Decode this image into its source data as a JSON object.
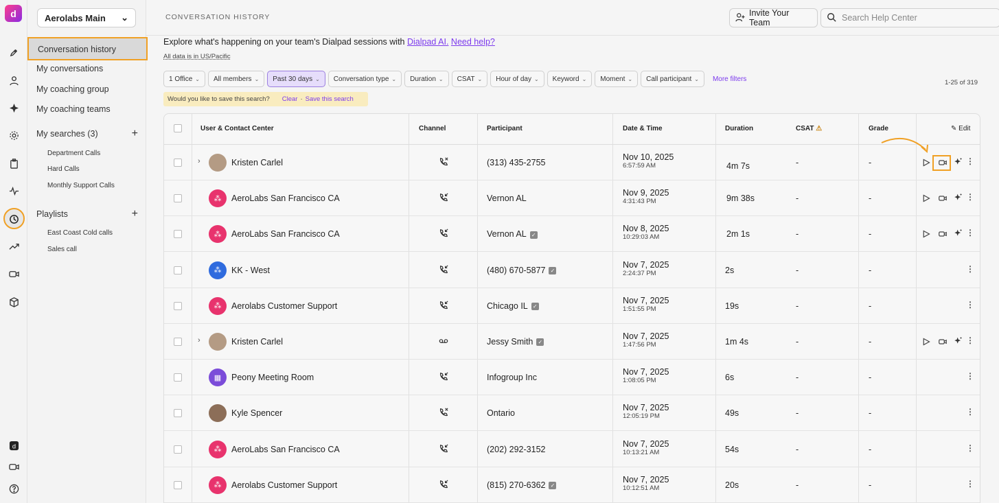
{
  "rail": {
    "logo": "d"
  },
  "sidebar": {
    "workspace": "Aerolabs Main",
    "items": [
      "Conversation history",
      "My conversations",
      "My coaching group",
      "My coaching teams"
    ],
    "searches_title": "My searches (3)",
    "searches": [
      "Department Calls",
      "Hard Calls",
      "Monthly Support Calls"
    ],
    "playlists_title": "Playlists",
    "playlists": [
      "East Coast Cold calls",
      "Sales call"
    ]
  },
  "header": {
    "title": "CONVERSATION HISTORY",
    "invite": "Invite Your Team",
    "search_placeholder": "Search Help Center"
  },
  "intro": {
    "text": "Explore what's happening on your team's Dialpad sessions with ",
    "link1": "Dialpad AI.",
    "link2": "Need help?",
    "timezone": "All data is in US/Pacific"
  },
  "filters": [
    "1 Office",
    "All members",
    "Past 30 days",
    "Conversation type",
    "Duration",
    "CSAT",
    "Hour of day",
    "Keyword",
    "Moment",
    "Call participant"
  ],
  "more_filters": "More filters",
  "count": "1-25 of 319",
  "savebar": {
    "question": "Would you like to save this search?",
    "clear": "Clear",
    "sep": "·",
    "save": "Save this search"
  },
  "columns": {
    "user": "User & Contact Center",
    "channel": "Channel",
    "participant": "Participant",
    "datetime": "Date & Time",
    "duration": "Duration",
    "csat": "CSAT",
    "grade": "Grade",
    "edit": "Edit"
  },
  "rows": [
    {
      "user": "Kristen Carlel",
      "participant": "(313) 435-2755",
      "date": "Nov 10, 2025",
      "time": "6:57:59 AM",
      "duration": "4m 7s",
      "csat": "-",
      "grade": "-"
    },
    {
      "user": "AeroLabs San Francisco CA",
      "participant": "Vernon AL",
      "date": "Nov 9, 2025",
      "time": "4:31:43 PM",
      "duration": "9m 38s",
      "csat": "-",
      "grade": "-"
    },
    {
      "user": "AeroLabs San Francisco CA",
      "participant": "Vernon AL",
      "date": "Nov 8, 2025",
      "time": "10:29:03 AM",
      "duration": "2m 1s",
      "csat": "-",
      "grade": "-"
    },
    {
      "user": "KK - West",
      "participant": "(480) 670-5877",
      "date": "Nov 7, 2025",
      "time": "2:24:37 PM",
      "duration": "2s",
      "csat": "-",
      "grade": "-"
    },
    {
      "user": "Aerolabs Customer Support",
      "participant": "Chicago IL",
      "date": "Nov 7, 2025",
      "time": "1:51:55 PM",
      "duration": "19s",
      "csat": "-",
      "grade": "-"
    },
    {
      "user": "Kristen Carlel",
      "participant": "Jessy Smith",
      "date": "Nov 7, 2025",
      "time": "1:47:56 PM",
      "duration": "1m 4s",
      "csat": "-",
      "grade": "-"
    },
    {
      "user": "Peony Meeting Room",
      "participant": "Infogroup Inc",
      "date": "Nov 7, 2025",
      "time": "1:08:05 PM",
      "duration": "6s",
      "csat": "-",
      "grade": "-"
    },
    {
      "user": "Kyle Spencer",
      "participant": "Ontario",
      "date": "Nov 7, 2025",
      "time": "12:05:19 PM",
      "duration": "49s",
      "csat": "-",
      "grade": "-"
    },
    {
      "user": "AeroLabs San Francisco CA",
      "participant": "(202) 292-3152",
      "date": "Nov 7, 2025",
      "time": "10:13:21 AM",
      "duration": "54s",
      "csat": "-",
      "grade": "-"
    },
    {
      "user": "Aerolabs Customer Support",
      "participant": "(815) 270-6362",
      "date": "Nov 7, 2025",
      "time": "10:12:51 AM",
      "duration": "20s",
      "csat": "-",
      "grade": "-"
    }
  ]
}
